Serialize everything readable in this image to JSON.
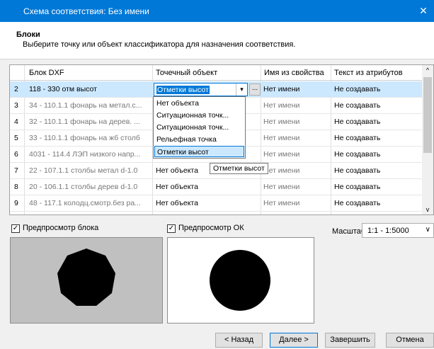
{
  "window": {
    "title": "Схема соответствия: Без имени",
    "close_glyph": "✕"
  },
  "header": {
    "title": "Блоки",
    "subtitle": "Выберите точку или объект классификатора для назначения соответствия."
  },
  "table": {
    "columns": [
      "Блок DXF",
      "Точечный объект",
      "Имя из свойства",
      "Текст из атрибутов"
    ],
    "rows": [
      {
        "num": "2",
        "block": "118 - 330 отм высот",
        "point": "Отметки высот",
        "name": "Нет имени",
        "text": "Не создавать"
      },
      {
        "num": "3",
        "block": "34 - 110.1.1 фонарь на  метал.с...",
        "point": "",
        "name": "Нет имени",
        "text": "Не создавать"
      },
      {
        "num": "4",
        "block": "32 - 110.1.1 фонарь на дерев. ...",
        "point": "",
        "name": "Нет имени",
        "text": "Не создавать"
      },
      {
        "num": "5",
        "block": "33 - 110.1.1 фонарь на жб столб",
        "point": "",
        "name": "Нет имени",
        "text": "Не создавать"
      },
      {
        "num": "6",
        "block": "4031 - 114.4 ЛЭП низкого напр...",
        "point": "",
        "name": "Нет имени",
        "text": "Не создавать"
      },
      {
        "num": "7",
        "block": "22 - 107.1.1 столбы метал d-1.0",
        "point": "Нет объекта",
        "name": "Нет имени",
        "text": "Не создавать"
      },
      {
        "num": "8",
        "block": "20 - 106.1.1 столбы дерев d-1.0",
        "point": "Нет объекта",
        "name": "Нет имени",
        "text": "Не создавать"
      },
      {
        "num": "9",
        "block": "48 - 117.1 колодц.смотр.без ра...",
        "point": "Нет объекта",
        "name": "Нет имени",
        "text": "Не создавать"
      }
    ],
    "ellipsis": "...",
    "dropdown_options": [
      "Нет объекта",
      "Ситуационная точк...",
      "Ситуационная точк...",
      "Рельефная точка",
      "Отметки высот"
    ],
    "tooltip": "Отметки высот"
  },
  "options": {
    "block_preview_label": "Предпросмотр блока",
    "ok_preview_label": "Предпросмотр ОК",
    "scale_label": "Масштаб:",
    "scale_value": "1:1 - 1:5000",
    "check_glyph": "✓"
  },
  "buttons": {
    "back": "< Назад",
    "next": "Далее >",
    "finish": "Завершить",
    "cancel": "Отмена"
  },
  "icons": {
    "dropdown": "▾",
    "scroll_up": "^",
    "scroll_down": "v",
    "combo_arrow": "∨"
  }
}
